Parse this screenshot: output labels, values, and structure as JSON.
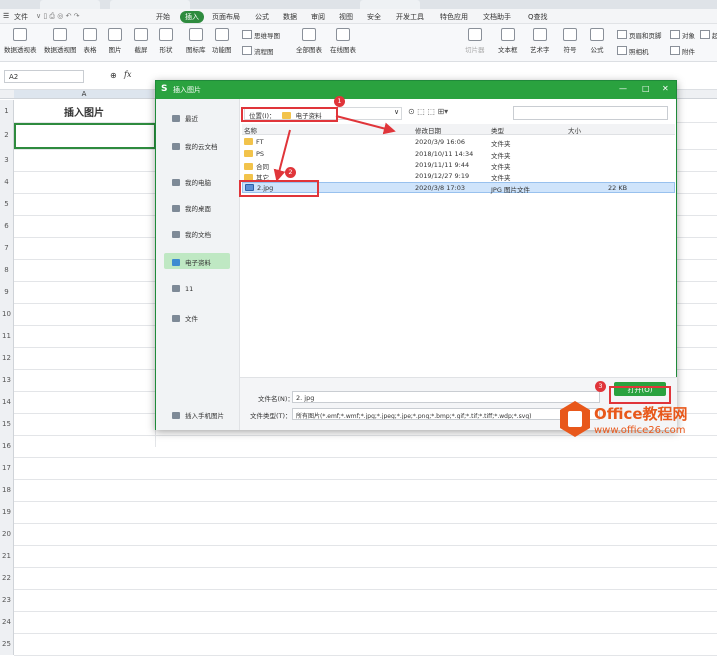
{
  "menubar": {
    "file_label": "文件",
    "items": [
      "开始",
      "插入",
      "页面布局",
      "公式",
      "数据",
      "审阅",
      "视图",
      "安全",
      "开发工具",
      "特色应用",
      "文档助手"
    ],
    "active_index": 1,
    "search_label": "Q查找"
  },
  "ribbon": {
    "buttons": [
      "数据透视表",
      "数据透视图",
      "表格",
      "图片",
      "截屏",
      "形状",
      "图标库",
      "功能图",
      "全部图表",
      "在线图表",
      "切片器",
      "文本框",
      "艺术字",
      "符号",
      "公式"
    ],
    "small": [
      "思维导图",
      "流程图",
      "页眉和页脚",
      "照相机",
      "对象",
      "附件",
      "超链"
    ]
  },
  "formula_bar": {
    "cell_ref": "A2",
    "fx": "fx"
  },
  "sheet": {
    "column_a": "A",
    "rows": [
      "1",
      "2",
      "3",
      "4",
      "5",
      "6",
      "7",
      "8",
      "9",
      "10",
      "11",
      "12",
      "13",
      "14",
      "15",
      "16",
      "17",
      "18",
      "19",
      "20",
      "21",
      "22",
      "23",
      "24",
      "25"
    ],
    "a1_text": "插入图片"
  },
  "dialog": {
    "title": "插入图片",
    "sidebar": [
      "最近",
      "我的云文档",
      "我的电脑",
      "我的桌面",
      "我的文档",
      "电子资料",
      "11",
      "文件"
    ],
    "selected_sidebar": "电子资料",
    "mobile_insert": "插入手机图片",
    "path_label": "位置(I)：",
    "path_value": "电子资料",
    "columns": {
      "name": "名称",
      "date": "修改日期",
      "type": "类型",
      "size": "大小"
    },
    "files": [
      {
        "name": "FT",
        "date": "2020/3/9 16:06",
        "type": "文件夹",
        "size": ""
      },
      {
        "name": "PS",
        "date": "2018/10/11 14:34",
        "type": "文件夹",
        "size": ""
      },
      {
        "name": "合同",
        "date": "2019/11/11 9:44",
        "type": "文件夹",
        "size": ""
      },
      {
        "name": "其它",
        "date": "2019/12/27 9:19",
        "type": "文件夹",
        "size": ""
      },
      {
        "name": "2.jpg",
        "date": "2020/3/8 17:03",
        "type": "JPG 图片文件",
        "size": "22 KB"
      }
    ],
    "filename_label": "文件名(N)：",
    "filename_value": "2. jpg",
    "filetype_label": "文件类型(T)：",
    "filetype_value": "所有图片(*.emf;*.wmf;*.jpg;*.jpeg;*.jpe;*.png;*.bmp;*.gif;*.tif;*.tiff;*.wdp;*.svg)",
    "open_button": "打开(O)"
  },
  "annotations": [
    "1",
    "2",
    "3"
  ],
  "watermark": {
    "brand": "Office教程网",
    "url": "www.office26.com"
  },
  "colors": {
    "accent_green": "#2aa23f",
    "annotation_red": "#e0353a",
    "selection_blue": "#cfe4fb"
  }
}
